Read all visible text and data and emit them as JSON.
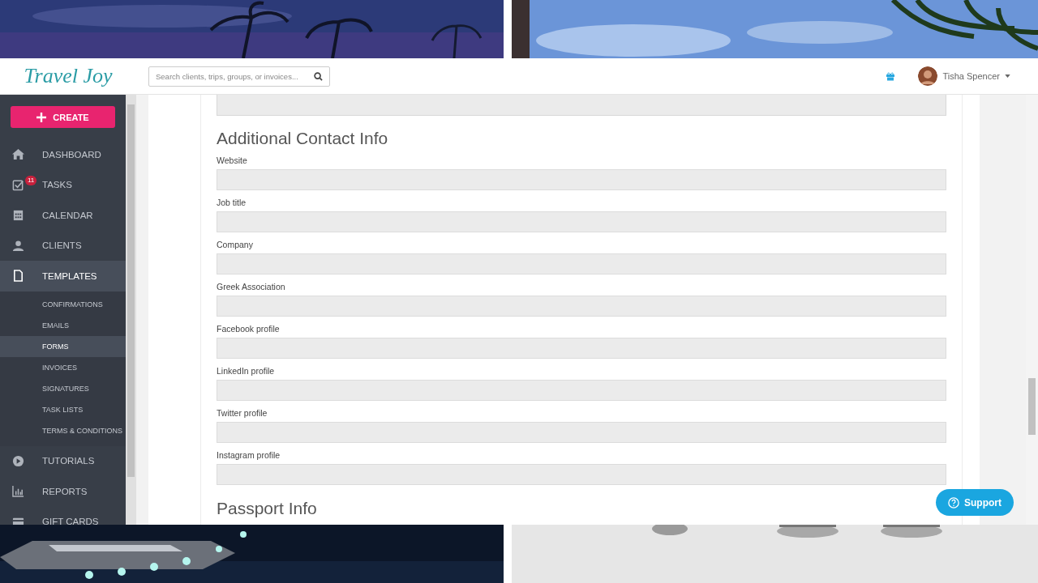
{
  "header": {
    "logo": "Travel Joy",
    "search": {
      "placeholder": "Search clients, trips, groups, or invoices..."
    },
    "user": "Tisha Spencer"
  },
  "sidebar": {
    "create_button": "CREATE",
    "items": [
      {
        "kind": "home",
        "label": "DASHBOARD",
        "selected": false
      },
      {
        "kind": "tasks",
        "label": "TASKS",
        "selected": false,
        "badge": "11"
      },
      {
        "kind": "calendar",
        "label": "CALENDAR",
        "selected": false
      },
      {
        "kind": "clients",
        "label": "CLIENTS",
        "selected": false
      },
      {
        "kind": "file",
        "label": "TEMPLATES",
        "selected": true,
        "children": [
          {
            "label": "CONFIRMATIONS",
            "selected": false
          },
          {
            "label": "EMAILS",
            "selected": false
          },
          {
            "label": "FORMS",
            "selected": true
          },
          {
            "label": "INVOICES",
            "selected": false
          },
          {
            "label": "SIGNATURES",
            "selected": false
          },
          {
            "label": "TASK LISTS",
            "selected": false
          },
          {
            "label": "TERMS & CONDITIONS",
            "selected": false
          }
        ]
      },
      {
        "kind": "play",
        "label": "TUTORIALS",
        "selected": false
      },
      {
        "kind": "chart",
        "label": "REPORTS",
        "selected": false
      },
      {
        "kind": "card",
        "label": "GIFT CARDS",
        "selected": false
      }
    ]
  },
  "form": {
    "sections": [
      {
        "title": "Additional Contact Info",
        "fields": [
          {
            "label": "Website"
          },
          {
            "label": "Job title"
          },
          {
            "label": "Company"
          },
          {
            "label": "Greek Association"
          },
          {
            "label": "Facebook profile"
          },
          {
            "label": "LinkedIn profile"
          },
          {
            "label": "Twitter profile"
          },
          {
            "label": "Instagram profile"
          }
        ]
      },
      {
        "title": "Passport Info"
      }
    ]
  },
  "support_button": "Support"
}
